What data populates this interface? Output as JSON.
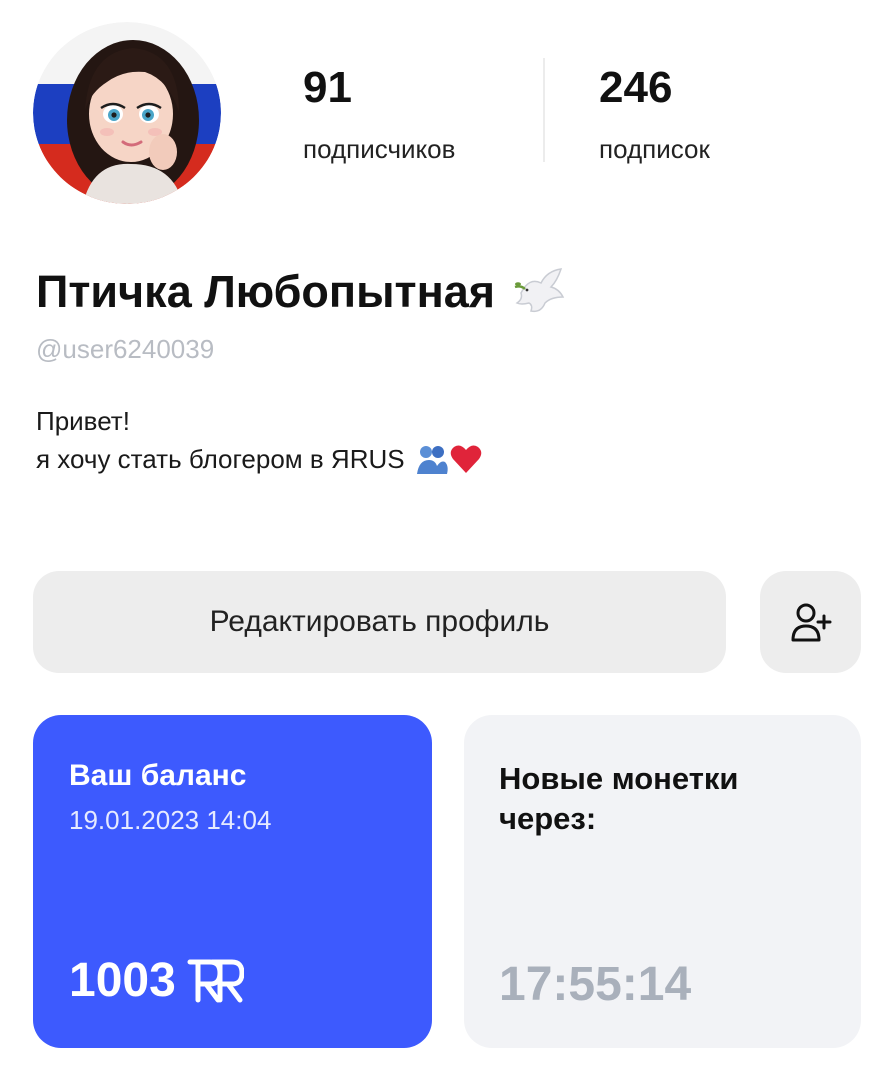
{
  "profile": {
    "name": "Птичка Любопытная",
    "handle": "@user6240039",
    "name_emoji_icon": "dove-icon",
    "bio_line1": "Привет!",
    "bio_line2": "я хочу стать блогером в ЯRUS",
    "bio_emoji_icons": [
      "people-hugging-icon",
      "red-heart-icon"
    ]
  },
  "stats": {
    "followers_value": "91",
    "followers_label": "подписчиков",
    "following_value": "246",
    "following_label": "подписок"
  },
  "actions": {
    "edit_label": "Редактировать профиль",
    "add_friend_icon": "add-user-icon"
  },
  "balance": {
    "title": "Ваш баланс",
    "date": "19.01.2023 14:04",
    "amount": "1003",
    "currency_icon": "yarus-currency-icon"
  },
  "coins": {
    "title": "Новые монетки через:",
    "timer": "17:55:14"
  },
  "colors": {
    "balance_card": "#3d5afe",
    "coins_card": "#f2f3f6",
    "button_bg": "#ededed",
    "handle_text": "#b8bcc3",
    "timer_text": "#a9b0bb",
    "flag_white": "#ffffff",
    "flag_blue": "#1c3fc1",
    "flag_red": "#d52b1e"
  }
}
